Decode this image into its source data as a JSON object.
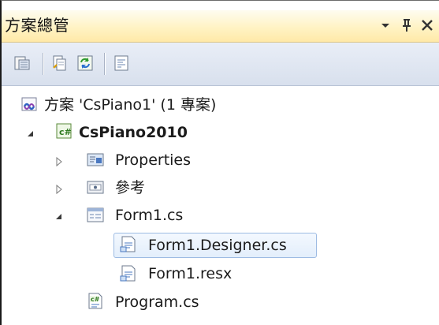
{
  "panel": {
    "title": "方案總管",
    "buttons": {
      "dropdown": "chevron-down-icon",
      "pin": "pin-icon",
      "close": "close-icon"
    }
  },
  "toolbar": {
    "items": [
      {
        "name": "properties-icon"
      },
      {
        "name": "show-all-files-icon"
      },
      {
        "name": "refresh-icon"
      },
      {
        "name": "view-code-icon"
      }
    ]
  },
  "tree": {
    "solution": "方案 'CsPiano1' (1 專案)",
    "project": "CsPiano2010",
    "properties": "Properties",
    "references": "參考",
    "form1": "Form1.cs",
    "designer": "Form1.Designer.cs",
    "resx": "Form1.resx",
    "program": "Program.cs"
  },
  "colors": {
    "accent": "#ffe9a8",
    "selection": "#e3eefb"
  }
}
